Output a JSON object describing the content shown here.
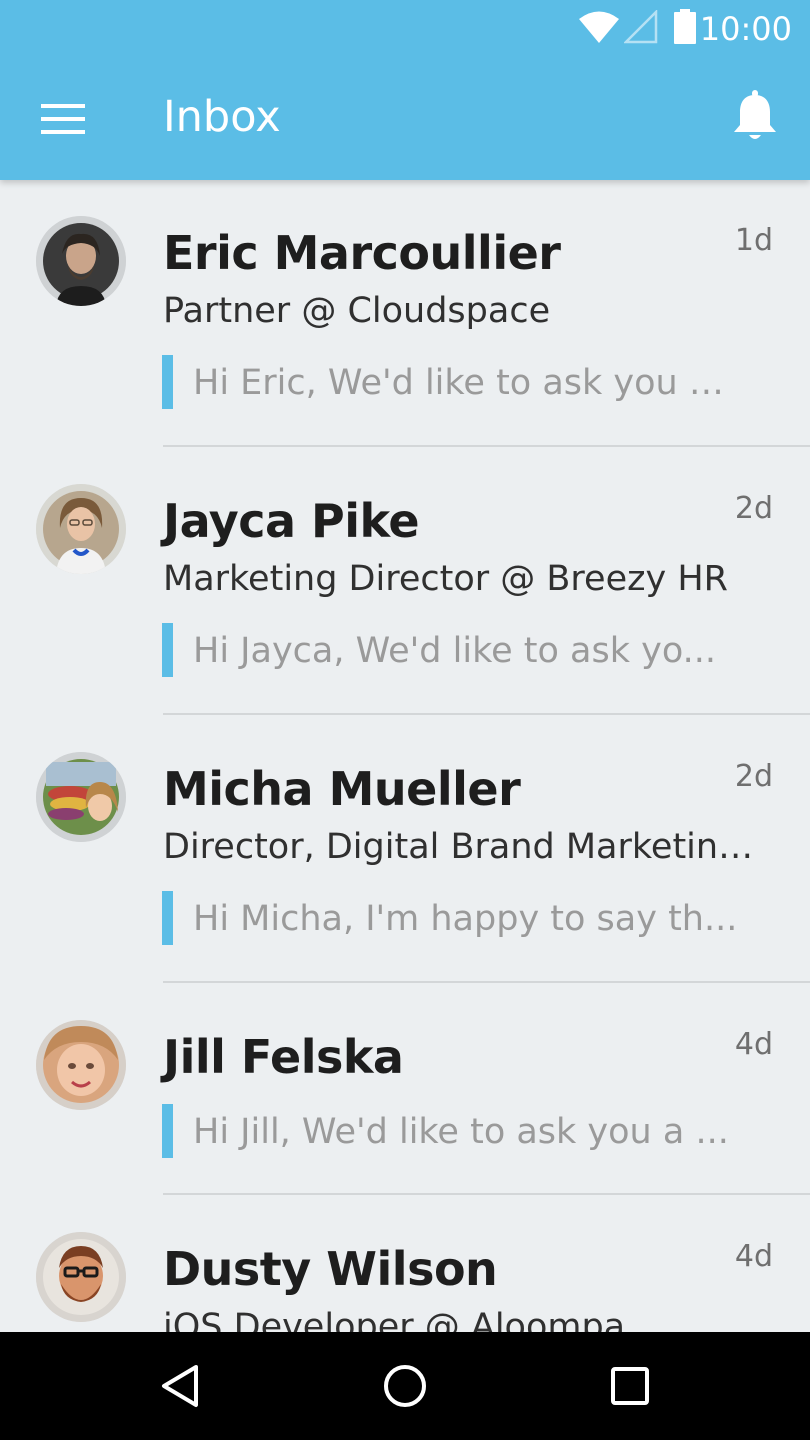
{
  "status_bar": {
    "time": "10:00",
    "icons": [
      "wifi-icon",
      "signal-icon",
      "battery-icon"
    ]
  },
  "app_bar": {
    "title": "Inbox",
    "menu_icon": "menu-icon",
    "notification_icon": "bell-icon",
    "color": "#5bbde6"
  },
  "messages": [
    {
      "name": "Eric Marcoullier",
      "subtitle": "Partner @ Cloudspace",
      "preview": "Hi Eric, We'd like to ask you a...",
      "date": "1d"
    },
    {
      "name": "Jayca Pike",
      "subtitle": "Marketing Director @ Breezy HR",
      "preview": "Hi Jayca, We'd like to ask yo...",
      "date": "2d"
    },
    {
      "name": "Micha Mueller",
      "subtitle": "Director, Digital Brand Marketing ...",
      "preview": "Hi Micha, I'm happy to say th...",
      "date": "2d"
    },
    {
      "name": "Jill Felska",
      "subtitle": "",
      "preview": "Hi Jill, We'd like to ask you a ...",
      "date": "4d"
    },
    {
      "name": "Dusty Wilson",
      "subtitle": "iOS Developer @ Aloompa",
      "preview": "",
      "date": "4d"
    }
  ],
  "nav_bar": {
    "icons": [
      "back-icon",
      "home-icon",
      "recents-icon"
    ]
  }
}
